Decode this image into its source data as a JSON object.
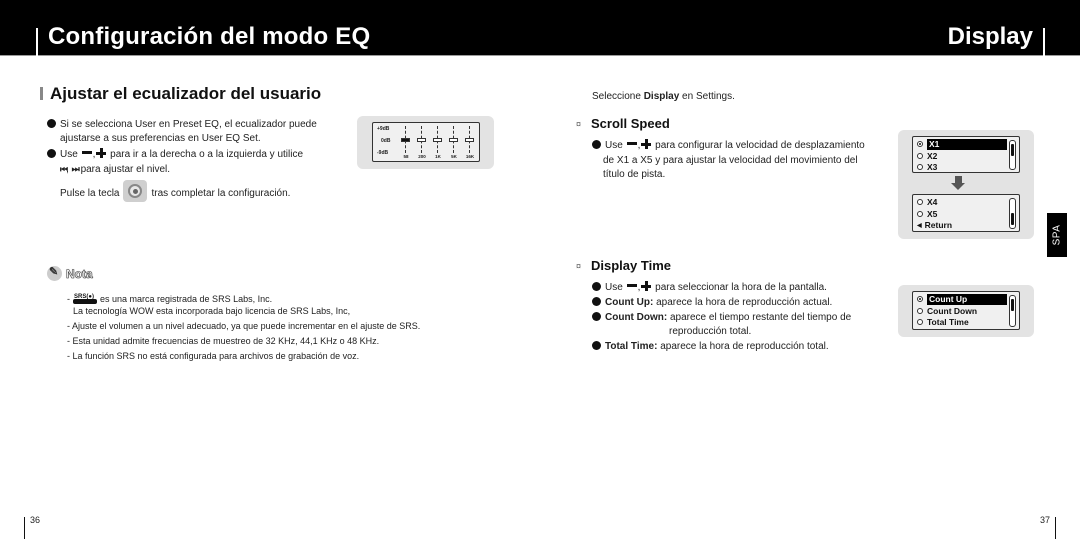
{
  "header": {
    "title_left": "Configuración del modo EQ",
    "title_right": "Display"
  },
  "left_page": {
    "section_title": "Ajustar el ecualizador del usuario",
    "bullets": [
      {
        "line1": "Si se selecciona User en Preset EQ, el ecualizador puede",
        "line2": "ajustarse a sus preferencias en User EQ Set."
      },
      {
        "line1_pre": "Use",
        "line1_post": "para ir a la derecha o a la izquierda y utilice",
        "line2_post": "para ajustar el nivel."
      }
    ],
    "press_pre": "Pulse la tecla",
    "press_post": "tras completar la configuración.",
    "icons": {
      "minus": "minus-button-icon",
      "plus": "plus-button-icon",
      "prev": "⏮",
      "next": "⏭",
      "joystick": "joystick-button-icon"
    },
    "eq_display": {
      "db_labels": [
        "+9dB",
        "0dB",
        "-9dB"
      ],
      "bands": [
        {
          "freq": "58",
          "level_db": 0,
          "selected": true
        },
        {
          "freq": "200",
          "level_db": 0,
          "selected": false
        },
        {
          "freq": "1K",
          "level_db": 0,
          "selected": false
        },
        {
          "freq": "5K",
          "level_db": 0,
          "selected": false
        },
        {
          "freq": "16K",
          "level_db": 0,
          "selected": false
        }
      ]
    },
    "note": {
      "title": "Nota",
      "srs_logo_text": "SRS(●)",
      "items": [
        {
          "prefix": "-",
          "text": "es una marca registrada de SRS Labs, Inc."
        },
        {
          "prefix": "",
          "text": "La tecnología WOW esta incorporada bajo licencia de SRS Labs, Inc,"
        },
        {
          "prefix": "",
          "text": "- Ajuste el volumen a un nivel adecuado, ya que puede incrementar en el ajuste de SRS."
        },
        {
          "prefix": "",
          "text": "- Esta unidad admite frecuencias de muestreo de 32 KHz, 44,1 KHz o 48 KHz."
        },
        {
          "prefix": "",
          "text": "- La función SRS no está configurada para archivos de grabación de voz."
        }
      ]
    },
    "page_number": "36"
  },
  "right_page": {
    "intro_pre": "Seleccione ",
    "intro_bold": "Display",
    "intro_post": " en Settings.",
    "scroll_speed": {
      "title": "Scroll Speed",
      "use": "Use",
      "line1": "para configurar la velocidad de desplazamiento",
      "line2": "de X1 a X5 y para ajustar la velocidad del movimiento del",
      "line3": "título de pista.",
      "screen1": [
        {
          "label": "X1",
          "selected": true
        },
        {
          "label": "X2",
          "selected": false
        },
        {
          "label": "X3",
          "selected": false
        }
      ],
      "screen2": [
        {
          "label": "X4",
          "selected": false
        },
        {
          "label": "X5",
          "selected": false
        },
        {
          "label": "Return",
          "type": "return"
        }
      ]
    },
    "display_time": {
      "title": "Display Time",
      "use": "Use",
      "line1": "para seleccionar la hora de la pantalla.",
      "items": [
        {
          "term": "Count Up:",
          "desc": "aparece la hora de reproducción actual."
        },
        {
          "term": "Count Down:",
          "desc": "aparece el tiempo restante del tiempo de",
          "desc2": "reproducción total."
        },
        {
          "term": "Total Time:",
          "desc": "aparece la hora de reproducción total."
        }
      ],
      "screen": [
        {
          "label": "Count Up",
          "selected": true
        },
        {
          "label": "Count Down",
          "selected": false
        },
        {
          "label": "Total Time",
          "selected": false
        }
      ]
    },
    "language_tab": "SPA",
    "page_number": "37"
  }
}
